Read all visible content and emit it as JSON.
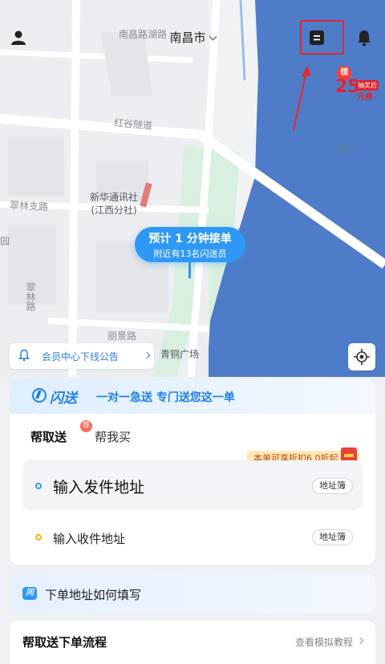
{
  "header": {
    "city": "南昌市"
  },
  "map": {
    "labels": {
      "top_road": "南昌路湖路",
      "hongu_tunnel": "红谷隧道",
      "landmark_line1": "新华通讯社",
      "landmark_line2": "(江西分社)",
      "cuilin": "翠林支路",
      "cuilin_vertical": "翠林路",
      "yuan": "园",
      "lijing": "丽景路",
      "qingtong": "青铜广场",
      "ganjiang": "赣江"
    },
    "colors": {
      "water": "#4f7cc8",
      "land": "#f1f2f4",
      "road": "#ffffff"
    }
  },
  "coupon": {
    "ling": "领",
    "amount": "25",
    "tag": "抽奖后",
    "unit": "元券"
  },
  "estimate": {
    "line1": "预计 1 分钟接单",
    "line2": "附近有13名闪送员"
  },
  "notice": {
    "text": "会员中心下线公告"
  },
  "card": {
    "brand_name": "闪送",
    "slogan": "一对一急送 专门送您这一单",
    "tabs": {
      "active": "帮取送",
      "active_badge": "荐",
      "second": "帮我买"
    },
    "discount_text": "本单可享折扣6.0折起",
    "send": {
      "label": "输入发件地址",
      "addr_book": "地址簿"
    },
    "receive": {
      "label": "输入收件地址",
      "addr_book": "地址簿"
    }
  },
  "howto": {
    "icon_text": "问",
    "text": "下单地址如何填写"
  },
  "process": {
    "title": "帮取送下单流程",
    "link": "查看模拟教程"
  },
  "colors": {
    "accent_blue": "#2f98f5",
    "annotation_red": "#e0292e",
    "tab_highlight": "#ffd23a"
  }
}
